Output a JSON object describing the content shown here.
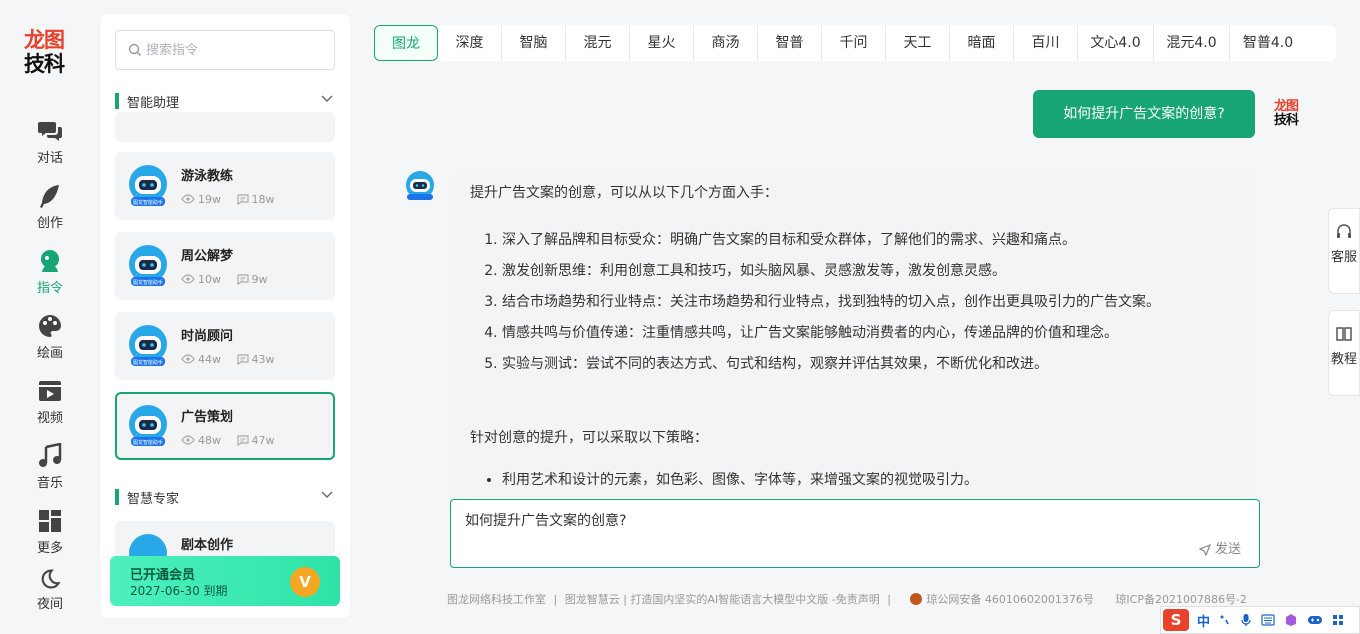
{
  "brand": {
    "line1": "龙图",
    "line2": "技科"
  },
  "nav": [
    {
      "label": "对话",
      "icon": "chat-bubbles-icon"
    },
    {
      "label": "创作",
      "icon": "feather-icon"
    },
    {
      "label": "指令",
      "icon": "user-command-icon"
    },
    {
      "label": "绘画",
      "icon": "palette-icon"
    },
    {
      "label": "视频",
      "icon": "video-icon"
    },
    {
      "label": "音乐",
      "icon": "music-note-icon"
    },
    {
      "label": "更多",
      "icon": "grid-icon"
    },
    {
      "label": "夜间",
      "icon": "moon-icon"
    }
  ],
  "sidebar": {
    "search_placeholder": "搜索指令",
    "section1": "智能助理",
    "section2": "智慧专家",
    "cards": [
      {
        "name": "游泳教练",
        "views": "19w",
        "comments": "18w"
      },
      {
        "name": "周公解梦",
        "views": "10w",
        "comments": "9w"
      },
      {
        "name": "时尚顾问",
        "views": "44w",
        "comments": "43w"
      },
      {
        "name": "广告策划",
        "views": "48w",
        "comments": "47w"
      }
    ],
    "partial_card": "剧本创作",
    "avatar_caption": "图龙智能助手",
    "vip": {
      "status": "已开通会员",
      "expiry": "2027-06-30 到期",
      "badge": "V"
    }
  },
  "models": [
    "图龙",
    "深度",
    "智脑",
    "混元",
    "星火",
    "商汤",
    "智普",
    "千问",
    "天工",
    "暗面",
    "百川",
    "文心4.0",
    "混元4.0",
    "智普4.0"
  ],
  "chat": {
    "user_message": "如何提升广告文案的创意?",
    "intro": "提升广告文案的创意，可以从以下几个方面入手：",
    "points": [
      "深入了解品牌和目标受众：明确广告文案的目标和受众群体，了解他们的需求、兴趣和痛点。",
      "激发创新思维：利用创意工具和技巧，如头脑风暴、灵感激发等，激发创意灵感。",
      "结合市场趋势和行业特点：关注市场趋势和行业特点，找到独特的切入点，创作出更具吸引力的广告文案。",
      "情感共鸣与价值传递：注重情感共鸣，让广告文案能够触动消费者的内心，传递品牌的价值和理念。",
      "实验与测试：尝试不同的表达方式、句式和结构，观察并评估其效果，不断优化和改进。"
    ],
    "strategy_intro": "针对创意的提升，可以采取以下策略：",
    "bullets": [
      "利用艺术和设计的元素，如色彩、图像、字体等，来增强文案的视觉吸引力。"
    ]
  },
  "composer": {
    "value": "如何提升广告文案的创意?",
    "send_label": "发送"
  },
  "float": {
    "service": "客服",
    "tutorial": "教程"
  },
  "footer": {
    "studio": "图龙网络科技工作室",
    "cloud": "图龙智慧云",
    "slogan": "打造国内坚实的AI智能语言大模型中文版",
    "disclaimer": "-免责声明",
    "police": "琼公网安备 46010602001376号",
    "icp": "琼ICP备2021007886号-2",
    "sep": "|"
  },
  "tray": {
    "logo": "S",
    "lang": "中"
  }
}
